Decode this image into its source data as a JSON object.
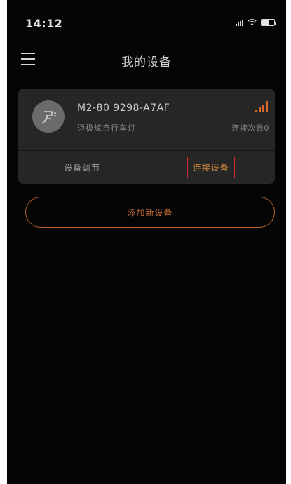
{
  "status_bar": {
    "time": "14:12"
  },
  "header": {
    "title": "我的设备"
  },
  "device": {
    "name": "M2-80 9298-A7AF",
    "type": "迈极炫自行车灯",
    "connect_count": "连接次数0",
    "signal_icon": "signal-bars-icon"
  },
  "actions": {
    "adjust_label": "设备调节",
    "connect_label": "连接设备"
  },
  "add_device_label": "添加新设备",
  "colors": {
    "background": "#050505",
    "card": "#262626",
    "accent": "#c06a36",
    "highlight_border": "#d92b2b"
  }
}
